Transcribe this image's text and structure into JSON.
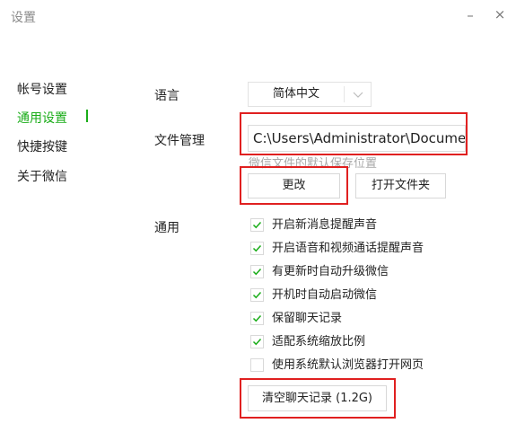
{
  "window": {
    "title": "设置",
    "minimize_glyph": "–",
    "close_glyph": "×"
  },
  "sidebar": {
    "items": [
      {
        "label": "帐号设置",
        "active": false
      },
      {
        "label": "通用设置",
        "active": true
      },
      {
        "label": "快捷按键",
        "active": false
      },
      {
        "label": "关于微信",
        "active": false
      }
    ]
  },
  "language": {
    "label": "语言",
    "value": "简体中文"
  },
  "file_mgmt": {
    "label": "文件管理",
    "path": "C:\\Users\\Administrator\\Documents\\WeChat Files",
    "hint": "微信文件的默认保存位置",
    "change_button": "更改",
    "open_folder_button": "打开文件夹"
  },
  "general": {
    "label": "通用",
    "options": [
      {
        "label": "开启新消息提醒声音",
        "checked": true
      },
      {
        "label": "开启语音和视频通话提醒声音",
        "checked": true
      },
      {
        "label": "有更新时自动升级微信",
        "checked": true
      },
      {
        "label": "开机时自动启动微信",
        "checked": true
      },
      {
        "label": "保留聊天记录",
        "checked": true
      },
      {
        "label": "适配系统缩放比例",
        "checked": true
      },
      {
        "label": "使用系统默认浏览器打开网页",
        "checked": false
      }
    ],
    "clear_history_button": "清空聊天记录 (1.2G)"
  },
  "colors": {
    "accent": "#1aad19",
    "highlight": "#e02020",
    "muted": "#a8a8a8"
  }
}
